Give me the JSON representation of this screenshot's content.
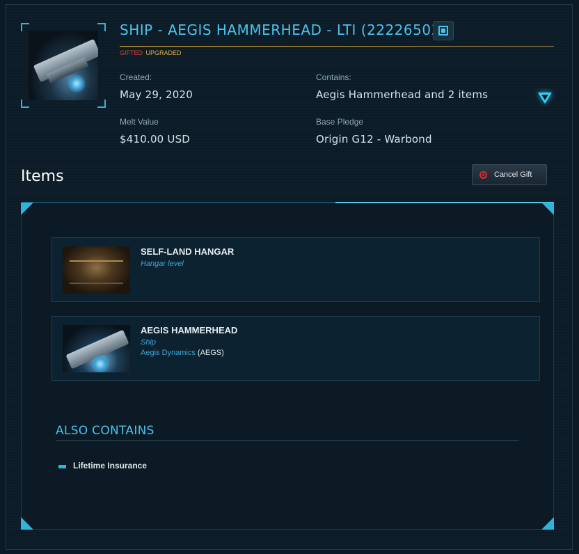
{
  "pledge": {
    "title": "SHIP - AEGIS HAMMERHEAD - LTI (22226503)",
    "tags": {
      "gifted": "GIFTED",
      "upgraded": "UPGRADED"
    },
    "created_label": "Created:",
    "created_value": "May 29, 2020",
    "contains_label": "Contains:",
    "contains_value": "Aegis Hammerhead and 2 items",
    "melt_label": "Melt Value",
    "melt_value": "$410.00 USD",
    "base_label": "Base Pledge",
    "base_value": "Origin G12 - Warbond",
    "icons": {
      "chip": "chip-icon",
      "expand": "expand-triangle-icon"
    },
    "accent_color": "#49c3ec"
  },
  "items_section": {
    "heading": "Items",
    "cancel_label": "Cancel Gift",
    "items": [
      {
        "name": "SELF-LAND HANGAR",
        "kind": "Hangar level"
      },
      {
        "name": "AEGIS HAMMERHEAD",
        "kind": "Ship",
        "manufacturer": "Aegis Dynamics",
        "code": " (AEGS)"
      }
    ]
  },
  "also_contains": {
    "heading": "ALSO CONTAINS",
    "items": [
      "Lifetime Insurance"
    ]
  }
}
